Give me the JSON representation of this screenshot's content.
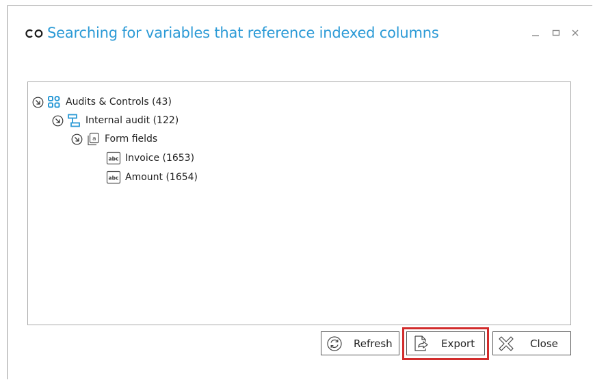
{
  "dialog": {
    "logo_text": "co",
    "title": "Searching for variables that reference indexed columns",
    "controls": {
      "minimize": "minimize-icon",
      "maximize": "maximize-icon",
      "close": "close-icon"
    }
  },
  "tree": {
    "audits": {
      "label": "Audits & Controls (43)",
      "icon": "process-group-icon"
    },
    "internal": {
      "label": "Internal audit (122)",
      "icon": "workflow-icon"
    },
    "form": {
      "label": "Form fields",
      "icon": "form-fields-icon"
    },
    "invoice": {
      "label": "Invoice (1653)",
      "icon": "text-field-icon"
    },
    "amount": {
      "label": "Amount (1654)",
      "icon": "text-field-icon"
    }
  },
  "buttons": {
    "refresh": "Refresh",
    "export": "Export",
    "close": "Close"
  },
  "colors": {
    "title": "#2b9ad6",
    "icon_blue": "#2b9ad6",
    "highlight": "#d22c2c"
  }
}
